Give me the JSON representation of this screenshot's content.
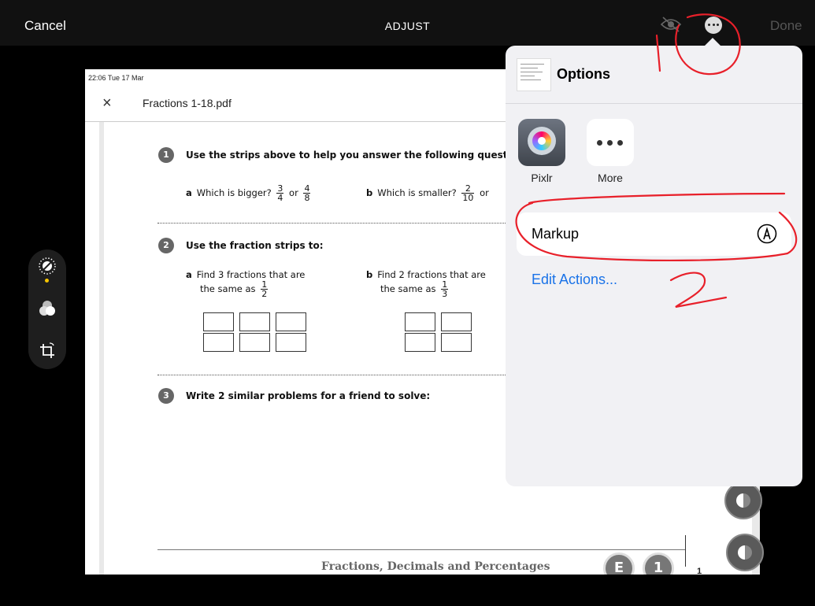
{
  "topbar": {
    "cancel": "Cancel",
    "title": "ADJUST",
    "done": "Done"
  },
  "document": {
    "status_time": "22:06  Tue 17 Mar",
    "close_symbol": "×",
    "filename": "Fractions 1-18.pdf",
    "q1": {
      "num": "1",
      "text": "Use the strips above to help you answer the following questions.",
      "a_letter": "a",
      "a_text": "Which is bigger?",
      "a_f1_n": "3",
      "a_f1_d": "4",
      "a_or": "or",
      "a_f2_n": "4",
      "a_f2_d": "8",
      "b_letter": "b",
      "b_text": "Which is smaller?",
      "b_f1_n": "2",
      "b_f1_d": "10",
      "b_or": "or"
    },
    "q2": {
      "num": "2",
      "text": "Use the fraction strips to:",
      "a_letter": "a",
      "a_line1": "Find 3 fractions that are",
      "a_line2": "the same as",
      "a_f_n": "1",
      "a_f_d": "2",
      "b_letter": "b",
      "b_line1": "Find 2 fractions that are",
      "b_line2": "the same as",
      "b_f_n": "1",
      "b_f_d": "3"
    },
    "q3": {
      "num": "3",
      "text": "Write 2 similar problems for a friend to solve:"
    },
    "footer": {
      "title": "Fractions, Decimals and Percentages",
      "badge1": "E",
      "badge2": "1",
      "page": "1"
    }
  },
  "popover": {
    "title": "Options",
    "apps": [
      {
        "label": "Pixlr",
        "icon": "pixlr-icon"
      },
      {
        "label": "More",
        "icon": "more-dots-icon"
      }
    ],
    "markup": "Markup",
    "edit_actions": "Edit Actions..."
  },
  "annotations": {
    "mark1": "1",
    "mark2": "2",
    "color": "#e8202a"
  },
  "colors": {
    "link": "#1a73e8",
    "done_disabled": "#555555",
    "accent_yellow": "#f5c400"
  }
}
